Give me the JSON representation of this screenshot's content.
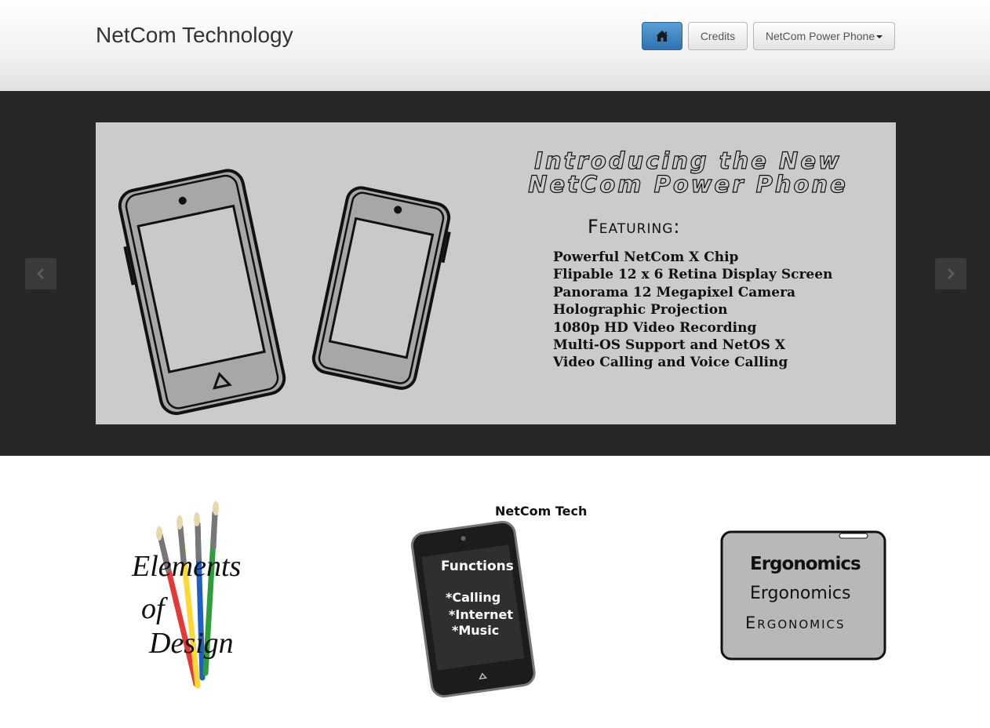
{
  "header": {
    "brand": "NetCom Technology",
    "nav": {
      "home_icon": "home-icon",
      "credits_label": "Credits",
      "phone_menu_label": "NetCom Power Phone"
    }
  },
  "carousel": {
    "prev_icon": "chevron-left-icon",
    "next_icon": "chevron-right-icon",
    "slide": {
      "title_line1": "Introducing the New",
      "title_line2": "NetCom Power Phone",
      "featuring_label": "Featuring:",
      "features": [
        "Powerful NetCom X Chip",
        "Flipable 12 x 6 Retina Display Screen",
        "Panorama 12 Megapixel Camera",
        "Holographic Projection",
        "1080p HD Video Recording",
        "Multi-OS Support and NetOS X",
        "Video Calling and Voice Calling"
      ]
    }
  },
  "thumbnails": {
    "design": {
      "line1": "Elements",
      "line2": "of",
      "line3": "Design"
    },
    "functions": {
      "caption": "NetCom Tech",
      "title": "Functions",
      "items": [
        "*Calling",
        "*Internet",
        "*Music"
      ]
    },
    "ergonomics": {
      "line1": "Ergonomics",
      "line2": "Ergonomics",
      "line3": "Ergonomics"
    }
  },
  "colors": {
    "home_button": "#337ab7",
    "hero_background": "#272727",
    "slide_background": "#cbcbcb",
    "brush_red": "#e53935",
    "brush_yellow": "#fdd835",
    "brush_blue": "#1e5fc4",
    "brush_green": "#2e9e3a"
  }
}
